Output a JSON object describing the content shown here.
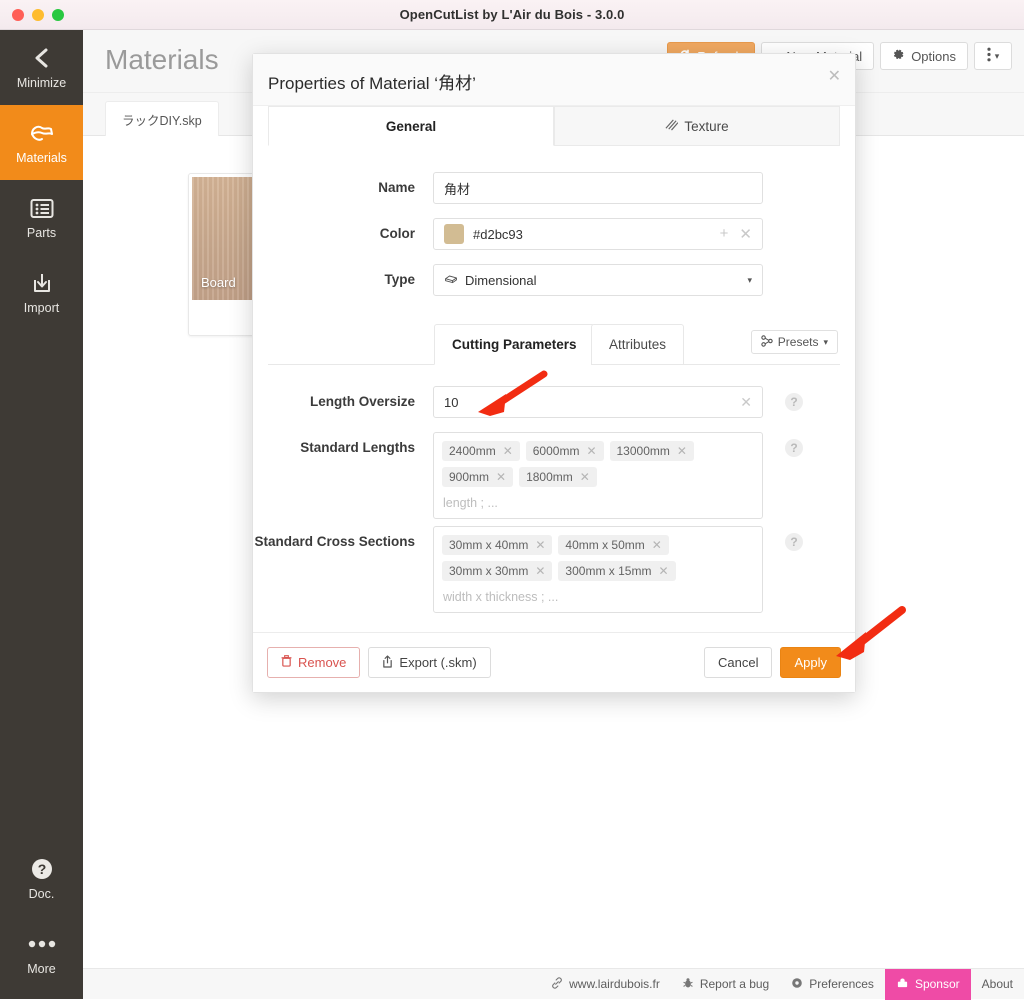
{
  "window": {
    "title": "OpenCutList by L'Air du Bois - 3.0.0"
  },
  "sidebar": {
    "items": [
      {
        "label": "Minimize",
        "icon": "chevron-left-icon",
        "active": false
      },
      {
        "label": "Materials",
        "icon": "materials-icon",
        "active": true
      },
      {
        "label": "Parts",
        "icon": "list-icon",
        "active": false
      },
      {
        "label": "Import",
        "icon": "import-icon",
        "active": false
      }
    ],
    "bottom_items": [
      {
        "label": "Doc.",
        "icon": "question-circle-icon"
      },
      {
        "label": "More",
        "icon": "ellipsis-icon"
      }
    ]
  },
  "main": {
    "page_title": "Materials",
    "file_tab": "ラックDIY.skp",
    "toolbar": {
      "refresh_label": "Refresh",
      "new_material_label": "New Material",
      "options_label": "Options",
      "kebab_label": "⋮"
    },
    "material_card": {
      "name": "Board",
      "badge_icon": "board-type-icon",
      "action_icons": [
        "duplicate-icon",
        "edit-icon"
      ]
    }
  },
  "dialog": {
    "title": "Properties of Material ‘角材’",
    "close_label": "✕",
    "tabs": [
      {
        "label": "General",
        "active": true,
        "icon": null
      },
      {
        "label": "Texture",
        "active": false,
        "icon": "texture-icon"
      }
    ],
    "fields": {
      "name": {
        "label": "Name",
        "value": "角材"
      },
      "color": {
        "label": "Color",
        "value": "#d2bc93",
        "swatch": "#d2bc93",
        "add_icon": "plus-icon",
        "clear_icon": "close-icon"
      },
      "type": {
        "label": "Type",
        "value": "Dimensional",
        "icon": "dimensional-icon",
        "caret": "▾"
      }
    },
    "sub_tabs": [
      {
        "label": "Cutting Parameters",
        "active": true
      },
      {
        "label": "Attributes",
        "active": false
      }
    ],
    "presets_button": {
      "label": "Presets",
      "icon": "presets-icon",
      "caret": "▾"
    },
    "cutting": {
      "length_oversize": {
        "label": "Length Oversize",
        "value": "10",
        "clear": "✕",
        "help": "?"
      },
      "standard_lengths": {
        "label": "Standard Lengths",
        "tags": [
          "2400mm",
          "6000mm",
          "13000mm",
          "900mm",
          "1800mm"
        ],
        "placeholder": "length ; ...",
        "help": "?"
      },
      "standard_cross_sections": {
        "label": "Standard Cross Sections",
        "tags": [
          "30mm x 40mm",
          "40mm x 50mm",
          "30mm x 30mm",
          "300mm x 15mm"
        ],
        "placeholder": "width x thickness ; ...",
        "help": "?"
      }
    },
    "footer": {
      "remove": {
        "label": "Remove",
        "icon": "trash-icon"
      },
      "export": {
        "label": "Export (.skm)",
        "icon": "export-icon"
      },
      "cancel": {
        "label": "Cancel"
      },
      "apply": {
        "label": "Apply"
      }
    }
  },
  "statusbar": {
    "items": [
      {
        "label": "www.lairdubois.fr",
        "icon": "link-icon",
        "style": "normal"
      },
      {
        "label": "Report a bug",
        "icon": "bug-icon",
        "style": "normal"
      },
      {
        "label": "Preferences",
        "icon": "gear-icon",
        "style": "normal"
      },
      {
        "label": "Sponsor",
        "icon": "sponsor-icon",
        "style": "sponsor"
      },
      {
        "label": "About",
        "icon": null,
        "style": "normal"
      }
    ]
  },
  "annotations": {
    "arrow_color": "#f22c12",
    "arrows": [
      {
        "target": "length-oversize-input"
      },
      {
        "target": "apply-button"
      }
    ]
  },
  "colors": {
    "accent_orange": "#f28b1a",
    "sponsor_pink": "#ef4ba6",
    "sidebar_dark": "#3e3a35",
    "material_color": "#d2bc93"
  }
}
